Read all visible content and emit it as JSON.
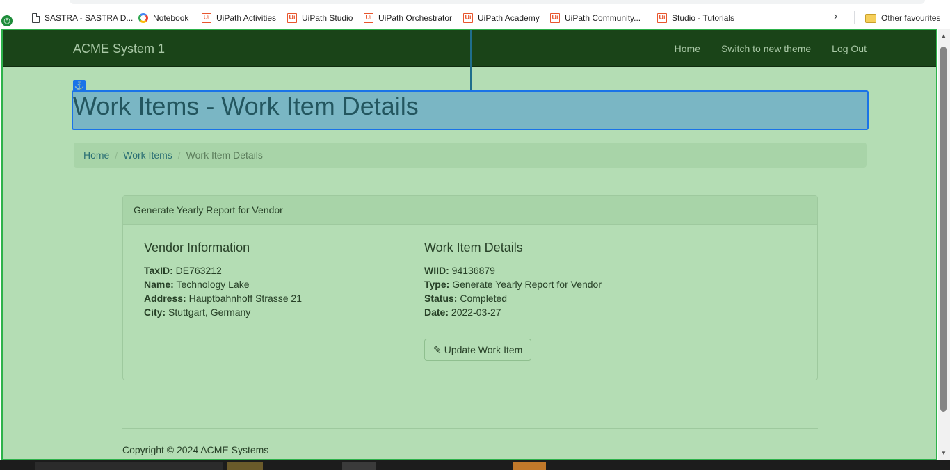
{
  "bookmarks": [
    {
      "label": "SASTRA - SASTRA D...",
      "icon": "document-icon"
    },
    {
      "label": "Notebook",
      "icon": "notebook-icon"
    },
    {
      "label": "UiPath Activities",
      "icon": "uipath-icon"
    },
    {
      "label": "UiPath Studio",
      "icon": "uipath-icon"
    },
    {
      "label": "UiPath Orchestrator",
      "icon": "uipath-icon"
    },
    {
      "label": "UiPath Academy",
      "icon": "uipath-icon"
    },
    {
      "label": "UiPath Community...",
      "icon": "uipath-icon"
    },
    {
      "label": "Studio - Tutorials",
      "icon": "uipath-icon"
    }
  ],
  "other_favourites": "Other favourites",
  "navbar": {
    "brand": "ACME System 1",
    "links": [
      "Home",
      "Switch to new theme",
      "Log Out"
    ]
  },
  "page_title": "Work Items - Work Item Details",
  "breadcrumb": [
    "Home",
    "Work Items",
    "Work Item Details"
  ],
  "panel": {
    "heading": "Generate Yearly Report for Vendor",
    "vendor": {
      "title": "Vendor Information",
      "fields": [
        {
          "label": "TaxID:",
          "value": "DE763212"
        },
        {
          "label": "Name:",
          "value": "Technology Lake"
        },
        {
          "label": "Address:",
          "value": "Hauptbahnhoff Strasse 21"
        },
        {
          "label": "City:",
          "value": "Stuttgart, Germany"
        }
      ]
    },
    "details": {
      "title": "Work Item Details",
      "fields": [
        {
          "label": "WIID:",
          "value": "94136879"
        },
        {
          "label": "Type:",
          "value": "Generate Yearly Report for Vendor"
        },
        {
          "label": "Status:",
          "value": "Completed"
        },
        {
          "label": "Date:",
          "value": "2022-03-27"
        }
      ]
    },
    "button": "Update Work Item"
  },
  "footer": "Copyright © 2024 ACME Systems",
  "colors": {
    "navbar": "#1a4418",
    "page_bg": "#b4ddb4",
    "highlight": "#7ab6c4",
    "selection_border": "#1a73e8"
  }
}
